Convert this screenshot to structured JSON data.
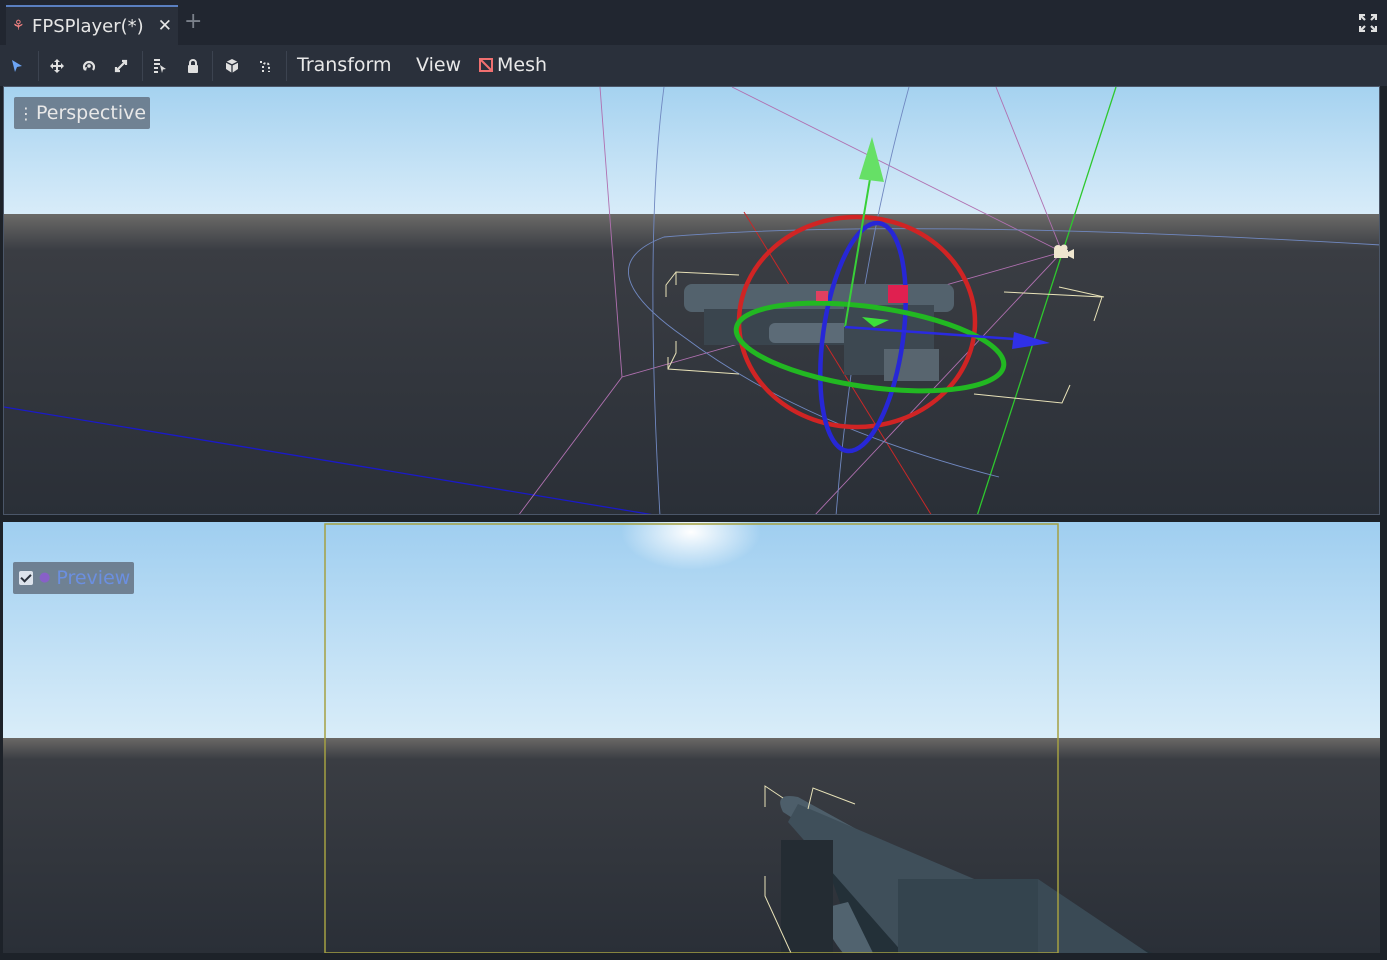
{
  "tabs": [
    {
      "label": "FPSPlayer(*)",
      "icon": "scene-node-icon"
    }
  ],
  "toolbar": {
    "menus": {
      "transform": "Transform",
      "view": "View",
      "mesh": "Mesh"
    },
    "tools": [
      "select-tool-icon",
      "move-tool-icon",
      "rotate-tool-icon",
      "scale-tool-icon",
      "list-select-icon",
      "lock-icon",
      "local-space-icon",
      "snap-icon"
    ]
  },
  "viewports": {
    "top": {
      "label": "Perspective"
    },
    "bottom": {
      "label": "Preview",
      "preview_checked": true
    }
  },
  "colors": {
    "accent": "#5a7fc0",
    "sky_top": "#a8d4f2",
    "ground": "#2b3038",
    "gizmo_x": "#d62828",
    "gizmo_y": "#2fc62f",
    "gizmo_z": "#2d2dd8"
  }
}
